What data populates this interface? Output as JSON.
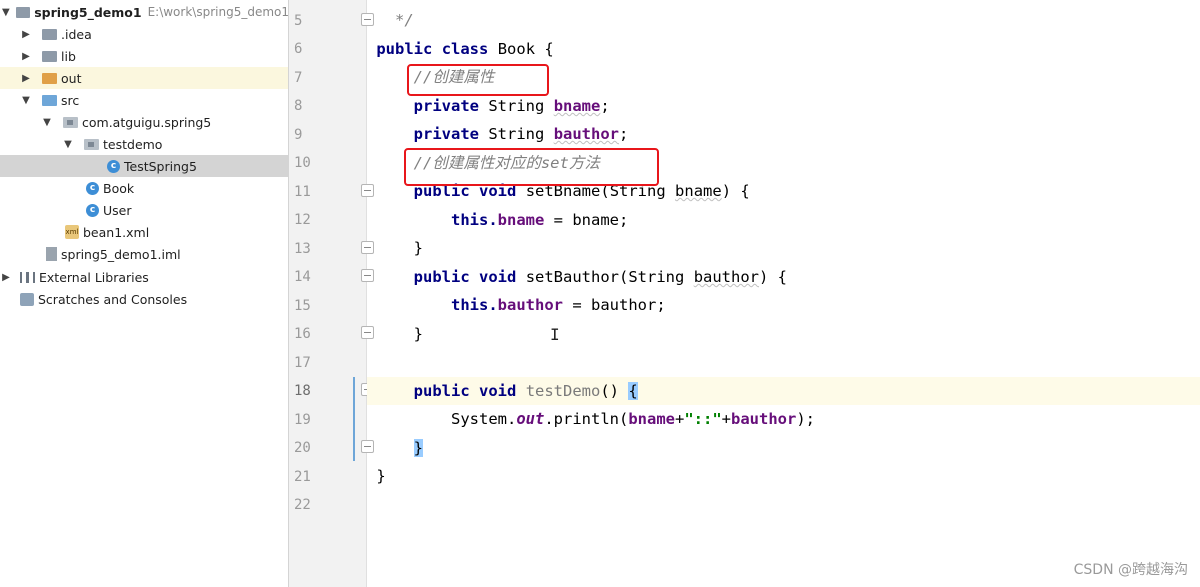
{
  "project_tree": {
    "root": {
      "name": "spring5_demo1",
      "path": "E:\\work\\spring5_demo1"
    },
    "items": [
      {
        "label": ".idea"
      },
      {
        "label": "lib"
      },
      {
        "label": "out"
      },
      {
        "label": "src"
      },
      {
        "label": "com.atguigu.spring5"
      },
      {
        "label": "testdemo"
      },
      {
        "label": "TestSpring5"
      },
      {
        "label": "Book"
      },
      {
        "label": "User"
      },
      {
        "label": "bean1.xml"
      },
      {
        "label": "spring5_demo1.iml"
      },
      {
        "label": "External Libraries"
      },
      {
        "label": "Scratches and Consoles"
      }
    ]
  },
  "editor": {
    "line_numbers": [
      "5",
      "6",
      "7",
      "8",
      "9",
      "10",
      "11",
      "12",
      "13",
      "14",
      "15",
      "16",
      "17",
      "18",
      "19",
      "20",
      "21",
      "22"
    ],
    "current_line": "18",
    "code": {
      "l5": {
        "t1": " */"
      },
      "l6": {
        "kw1": "public",
        "kw2": "class",
        "t1": "Book {"
      },
      "l7": {
        "cmt": "//创建属性"
      },
      "l8": {
        "kw1": "private",
        "t1": "String",
        "fld": "bname",
        "t2": ";"
      },
      "l9": {
        "kw1": "private",
        "t1": "String",
        "fld": "bauthor",
        "t2": ";"
      },
      "l10": {
        "cmt": "//创建属性对应的set方法"
      },
      "l11": {
        "kw1": "public",
        "kw2": "void",
        "t1": "setBname(",
        "t2": "String",
        "t3": "bname",
        "t4": ") {"
      },
      "l12": {
        "kw1": "this.",
        "fld": "bname",
        "t1": " = bname;"
      },
      "l13": {
        "t1": "}"
      },
      "l14": {
        "kw1": "public",
        "kw2": "void",
        "t1": "setBauthor(",
        "t2": "String",
        "t3": "bauthor",
        "t4": ") {"
      },
      "l15": {
        "kw1": "this.",
        "fld": "bauthor",
        "t1": " = bauthor;"
      },
      "l16": {
        "t1": "}"
      },
      "l18": {
        "kw1": "public",
        "kw2": "void",
        "t1": "testDemo",
        "t2": "()",
        "t3": "{"
      },
      "l19": {
        "t1": "System.",
        "static": "out",
        "t2": ".println(",
        "fld1": "bname",
        "t3": "+",
        "str": "\"::\"",
        "t4": "+",
        "fld2": "bauthor",
        "t5": ");"
      },
      "l20": {
        "t1": "}"
      },
      "l21": {
        "t1": "}"
      }
    }
  },
  "watermark": "CSDN @跨越海沟",
  "colors": {
    "keyword": "#000080",
    "field": "#660e7a",
    "comment": "#808080",
    "string": "#008000",
    "annotation_box": "#e8161b",
    "current_line_bg": "#fefbe8",
    "selected_tree_bg": "#d4d4d4"
  }
}
